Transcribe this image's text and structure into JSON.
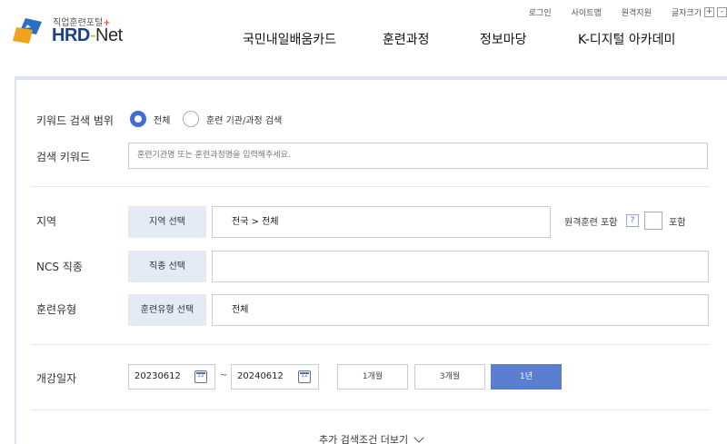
{
  "util_links": [
    "로그인",
    "사이트맵",
    "원격지원"
  ],
  "font_size": {
    "label": "글자크기",
    "plus": "+",
    "minus": "-"
  },
  "logo": {
    "subtitle": "직업훈련포털",
    "plus": "+",
    "brand_a": "HRD",
    "dash": "-",
    "brand_b": "Net"
  },
  "gnb": [
    "국민내일배움카드",
    "훈련과정",
    "정보마당",
    "K-디지털 아카데미"
  ],
  "search": {
    "scope_label": "키워드 검색 범위",
    "scope_options": [
      {
        "label": "전체",
        "selected": true
      },
      {
        "label": "훈련 기관/과정 검색",
        "selected": false
      }
    ],
    "keyword_label": "검색 키워드",
    "keyword_placeholder": "훈련기관명 또는 훈련과정명을 입력해주세요.",
    "region": {
      "label": "지역",
      "button": "지역 선택",
      "value": "전국 > 전체"
    },
    "remote": {
      "label": "원격훈련 포함",
      "help": "?",
      "check_label": "포함",
      "checked": false
    },
    "ncs": {
      "label": "NCS 직종",
      "button": "직종 선택",
      "value": ""
    },
    "type": {
      "label": "훈련유형",
      "button": "훈련유형 선택",
      "value": "전체"
    },
    "date": {
      "label": "개강일자",
      "start": "20230612",
      "end": "20240612",
      "separator": "~",
      "calendar_icon_text": "12",
      "periods": [
        {
          "label": "1개월",
          "active": false
        },
        {
          "label": "3개월",
          "active": false
        },
        {
          "label": "1년",
          "active": true
        }
      ]
    },
    "more": "추가 검색조건 더보기"
  },
  "colors": {
    "accent": "#3d6fd6",
    "active_button": "#5b7fd0",
    "select_button": "#e4ebf7",
    "brand": "#1a3f8b"
  }
}
